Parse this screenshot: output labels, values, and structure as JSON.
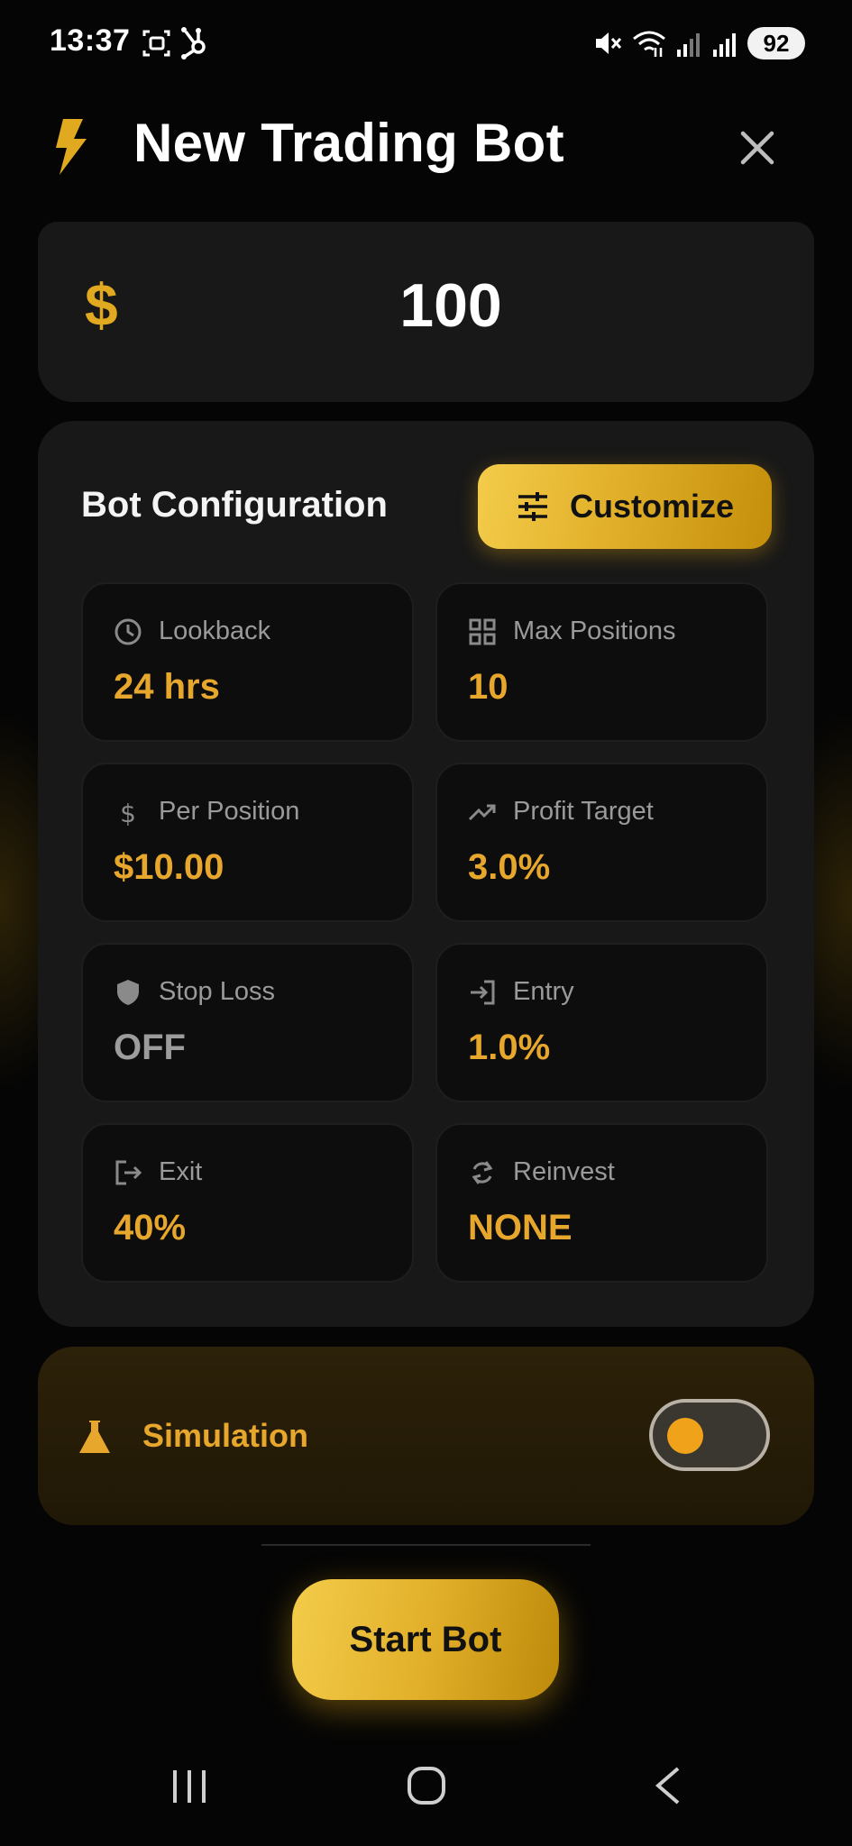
{
  "status_bar": {
    "time": "13:37",
    "battery": "92"
  },
  "header": {
    "title": "New Trading Bot"
  },
  "amount": {
    "currency_symbol": "$",
    "value": "100"
  },
  "config": {
    "title": "Bot Configuration",
    "customize_label": "Customize",
    "tiles": [
      {
        "label": "Lookback",
        "value": "24 hrs",
        "icon": "clock-icon"
      },
      {
        "label": "Max Positions",
        "value": "10",
        "icon": "grid-icon"
      },
      {
        "label": "Per Position",
        "value": "$10.00",
        "icon": "dollar-icon"
      },
      {
        "label": "Profit Target",
        "value": "3.0%",
        "icon": "trending-up-icon"
      },
      {
        "label": "Stop Loss",
        "value": "OFF",
        "icon": "shield-icon"
      },
      {
        "label": "Entry",
        "value": "1.0%",
        "icon": "login-icon"
      },
      {
        "label": "Exit",
        "value": "40%",
        "icon": "logout-icon"
      },
      {
        "label": "Reinvest",
        "value": "NONE",
        "icon": "sync-icon"
      }
    ]
  },
  "simulation": {
    "label": "Simulation",
    "enabled": false
  },
  "actions": {
    "start_label": "Start Bot"
  },
  "colors": {
    "accent": "#e6a72c",
    "gold_light": "#f3cc4a",
    "card_bg": "#181818",
    "tile_bg": "#0d0d0d",
    "muted_text": "#9a9a9a"
  }
}
